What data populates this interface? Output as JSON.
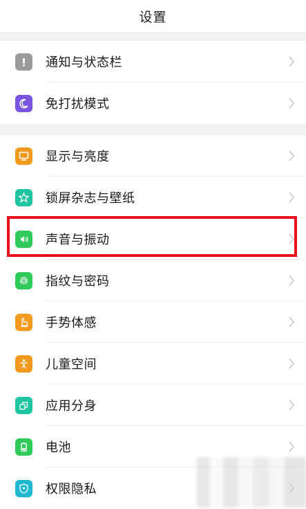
{
  "header": {
    "title": "设置"
  },
  "groups": [
    {
      "items": [
        {
          "label": "通知与状态栏",
          "icon": "notification-icon",
          "color": "#9a9a9a"
        },
        {
          "label": "免打扰模式",
          "icon": "moon-icon",
          "color": "#7a55e0"
        }
      ]
    },
    {
      "items": [
        {
          "label": "显示与亮度",
          "icon": "display-icon",
          "color": "#f39a1e"
        },
        {
          "label": "锁屏杂志与壁纸",
          "icon": "wallpaper-icon",
          "color": "#1fc4a0"
        },
        {
          "label": "声音与振动",
          "icon": "sound-icon",
          "color": "#2fca5a"
        },
        {
          "label": "指纹与密码",
          "icon": "fingerprint-icon",
          "color": "#2fca5a"
        },
        {
          "label": "手势体感",
          "icon": "gesture-icon",
          "color": "#f39a1e"
        },
        {
          "label": "儿童空间",
          "icon": "child-icon",
          "color": "#f39a1e"
        },
        {
          "label": "应用分身",
          "icon": "clone-icon",
          "color": "#1fc4a0"
        },
        {
          "label": "电池",
          "icon": "battery-icon",
          "color": "#2fca5a"
        },
        {
          "label": "权限隐私",
          "icon": "privacy-icon",
          "color": "#1fb8d0"
        }
      ]
    }
  ]
}
